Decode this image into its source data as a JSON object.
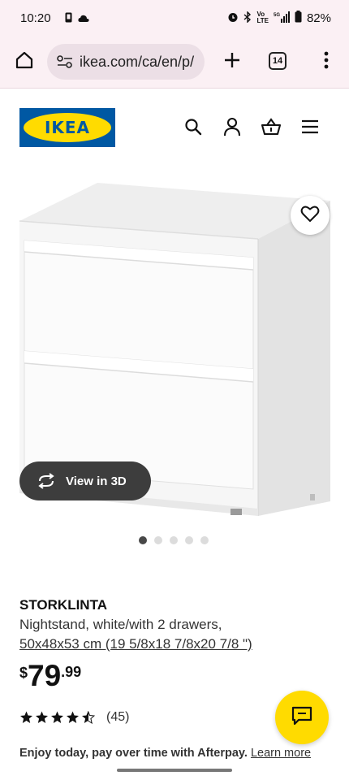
{
  "status_bar": {
    "time": "10:20",
    "battery": "82%",
    "network": "5G"
  },
  "browser": {
    "url": "ikea.com/ca/en/p/",
    "tab_count": "14"
  },
  "header": {
    "logo_text": "IKEA"
  },
  "product": {
    "view_3d_label": "View in 3D",
    "image_count": 5,
    "active_image": 1,
    "name": "STORKLINTA",
    "description": "Nightstand, white/with 2 drawers,",
    "size": "50x48x53 cm (19 5/8x18 7/8x20 7/8 \")",
    "price_currency": "$",
    "price_int": "79",
    "price_dec": ".99",
    "rating": 4.5,
    "review_count": "(45)"
  },
  "afterpay": {
    "text": "Enjoy today, pay over time with Afterpay.",
    "link": "Learn more"
  },
  "colors": {
    "ikea_blue": "#0058a3",
    "ikea_yellow": "#ffdb00",
    "browser_bg": "#fbf0f4"
  }
}
